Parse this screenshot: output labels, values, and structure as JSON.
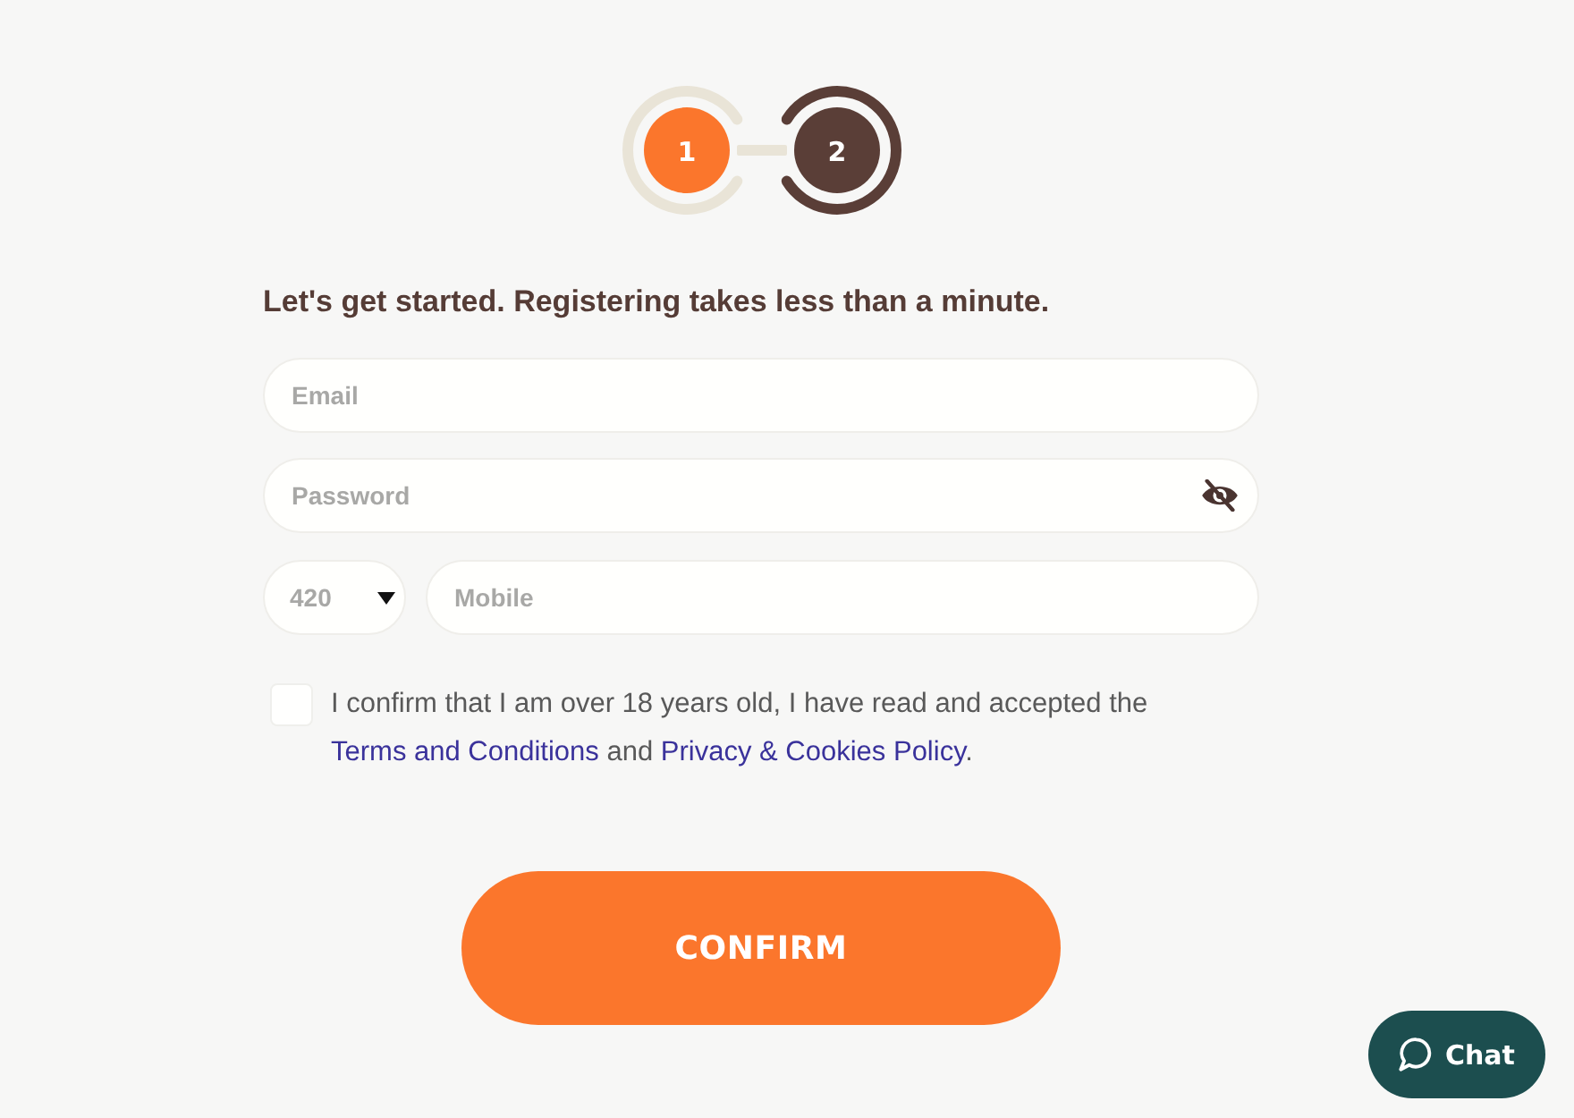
{
  "stepper": {
    "steps": [
      {
        "label": "1",
        "selected": true
      },
      {
        "label": "2",
        "selected": false
      }
    ]
  },
  "heading": "Let's get started. Registering takes less than a minute.",
  "form": {
    "email": {
      "placeholder": "Email"
    },
    "password": {
      "placeholder": "Password",
      "revealed": false
    },
    "country_code": {
      "value": "420"
    },
    "mobile": {
      "placeholder": "Mobile"
    }
  },
  "consent": {
    "checked": false,
    "parts": [
      {
        "kind": "text",
        "text": "I confirm that I am over 18 years old, I have read and accepted the "
      },
      {
        "kind": "link",
        "text": "Terms and Conditions"
      },
      {
        "kind": "text",
        "text": " and "
      },
      {
        "kind": "link",
        "text": "Privacy & Cookies Policy"
      },
      {
        "kind": "text",
        "text": "."
      }
    ]
  },
  "confirm_button": "CONFIRM",
  "chat_button": "Chat"
}
